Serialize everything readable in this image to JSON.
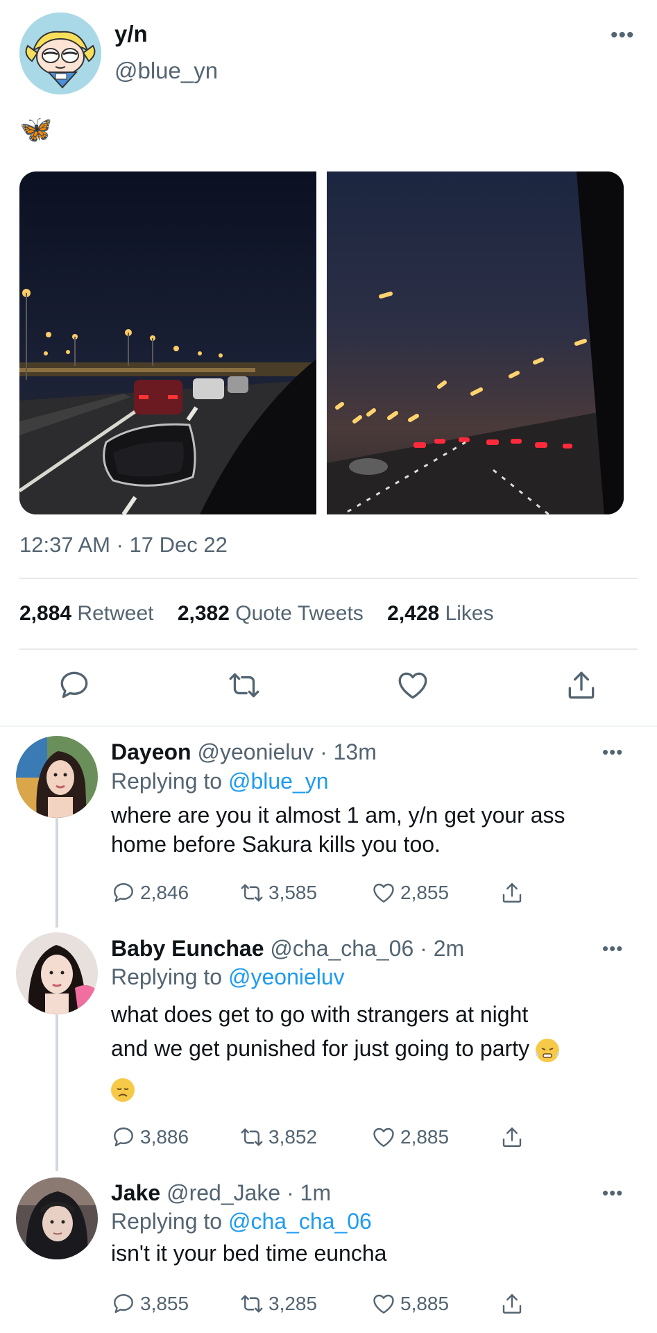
{
  "main_tweet": {
    "display_name": "y/n",
    "handle": "@blue_yn",
    "text": "🦋",
    "timestamp": "12:37 AM · 17 Dec 22",
    "stats": [
      {
        "count": "2,884",
        "label": "Retweet"
      },
      {
        "count": "2,382",
        "label": "Quote Tweets"
      },
      {
        "count": "2,428",
        "label": "Likes"
      }
    ]
  },
  "replies": [
    {
      "name": "Dayeon",
      "handle_time": "@yeonieluv · 13m",
      "replying_prefix": "Replying to",
      "replying_to": "@blue_yn",
      "text_line1": "where are you it almost 1 am, y/n get your ass",
      "text_line2": "home before Sakura kills you too.",
      "text_line3": "",
      "replies": "2,846",
      "retweets": "3,585",
      "likes": "2,855"
    },
    {
      "name": "Baby Eunchae",
      "handle_time": "@cha_cha_06 · 2m",
      "replying_prefix": "Replying to",
      "replying_to": "@yeonieluv",
      "text_line1": "what does get to go with strangers at night",
      "text_line2": "and we get punished for just going to party",
      "text_line3": "",
      "replies": "3,886",
      "retweets": "3,852",
      "likes": "2,885"
    },
    {
      "name": "Jake",
      "handle_time": "@red_Jake · 1m",
      "replying_prefix": "Replying to",
      "replying_to": "@cha_cha_06",
      "text_line1": "isn't it your bed time euncha",
      "text_line2": "",
      "text_line3": "",
      "replies": "3,855",
      "retweets": "3,285",
      "likes": "5,885"
    }
  ],
  "icons": {
    "reply": "speech-bubble-icon",
    "retweet": "retweet-arrows-icon",
    "like": "heart-icon",
    "share": "share-upload-icon",
    "more": "more-dots-icon"
  },
  "colors": {
    "link": "#1d9bf0",
    "secondary_text": "#536471",
    "primary_text": "#0f1419",
    "divider": "#e7e9ea"
  }
}
